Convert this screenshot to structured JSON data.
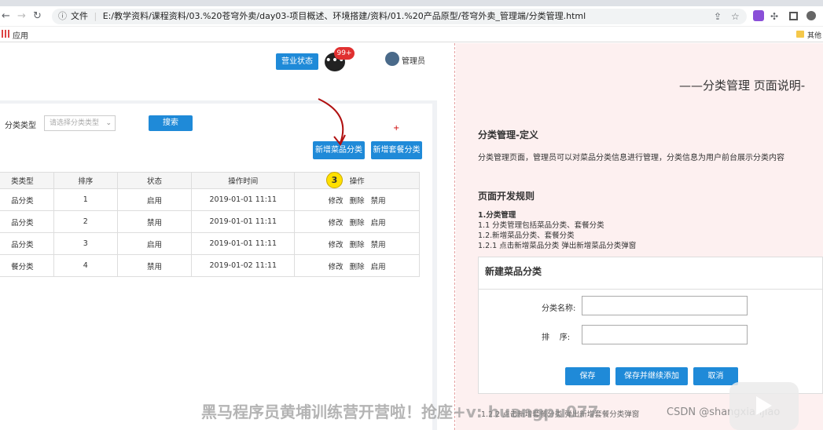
{
  "browser": {
    "url": "E:/教学资料/课程资料/03.%20苍穹外卖/day03-项目概述、环境搭建/资料/01.%20产品原型/苍穹外卖_管理端/分类管理.html",
    "file_label": "文件",
    "bookmark_apps": "应用",
    "bookmark_other": "其他"
  },
  "header": {
    "business_status": "营业状态",
    "badge": "99+",
    "admin": "管理员"
  },
  "search": {
    "label": "分类类型",
    "placeholder": "请选择分类类型",
    "button": "搜索"
  },
  "actions": {
    "add_dish_category": "新增菜品分类",
    "add_setmeal_category": "新增套餐分类",
    "plus": "+"
  },
  "marker": "3",
  "table": {
    "headers": [
      "类类型",
      "排序",
      "状态",
      "操作时间",
      "操作"
    ],
    "rows": [
      {
        "type": "品分类",
        "sort": "1",
        "status": "启用",
        "time": "2019-01-01 11:11",
        "ops": [
          "修改",
          "删除",
          "禁用"
        ]
      },
      {
        "type": "品分类",
        "sort": "2",
        "status": "禁用",
        "time": "2019-01-01 11:11",
        "ops": [
          "修改",
          "删除",
          "启用"
        ]
      },
      {
        "type": "品分类",
        "sort": "3",
        "status": "启用",
        "time": "2019-01-01 11:11",
        "ops": [
          "修改",
          "删除",
          "禁用"
        ]
      },
      {
        "type": "餐分类",
        "sort": "4",
        "status": "禁用",
        "time": "2019-01-02 11:11",
        "ops": [
          "修改",
          "删除",
          "启用"
        ]
      }
    ]
  },
  "doc": {
    "page_title": "——分类管理 页面说明-",
    "def_heading": "分类管理-定义",
    "def_text": "分类管理页面，管理员可以对菜品分类信息进行管理，分类信息为用户前台展示分类内容",
    "rules_heading": "页面开发规则",
    "rule_1": "1.分类管理",
    "rule_1_1": "1.1 分类管理包括菜品分类、套餐分类",
    "rule_1_2": "1.2.新增菜品分类、套餐分类",
    "rule_1_2_1": "1.2.1 点击新增菜品分类 弹出新增菜品分类弹窗",
    "rule_1_2_2": "1.2.2 点击新增套餐分类 弹出新增套餐分类弹窗"
  },
  "dialog": {
    "title": "新建菜品分类",
    "name_label": "分类名称:",
    "sort_label": "排    序:",
    "save": "保存",
    "save_continue": "保存并继续添加",
    "cancel": "取消"
  },
  "watermark": {
    "promo": "黑马程序员黄埔训练营开营啦！抢座+v: huangpu077",
    "csdn": "CSDN @shangxianjiao"
  },
  "colors": {
    "primary": "#1f8ad8",
    "doc_bg": "#fdf0f0",
    "badge": "#e03030",
    "marker": "#ffe000"
  }
}
